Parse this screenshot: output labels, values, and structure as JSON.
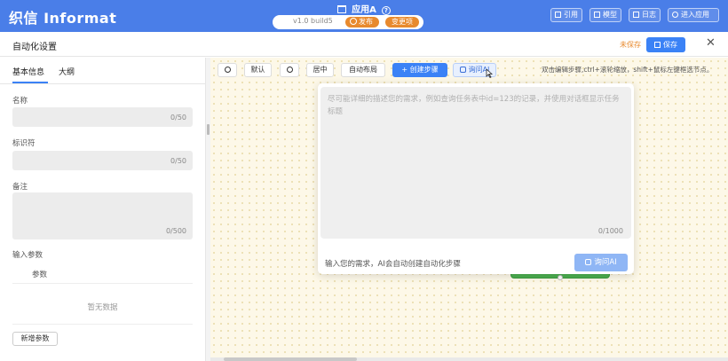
{
  "topbar": {
    "logo": "织信 Informat",
    "app_name": "应用A",
    "version": "v1.0 build5",
    "publish_label": "发布",
    "changes_label": "变更项",
    "actions": [
      {
        "label": "引用",
        "icon": "reference-icon"
      },
      {
        "label": "模型",
        "icon": "model-icon"
      },
      {
        "label": "日志",
        "icon": "log-icon"
      },
      {
        "label": "进入应用",
        "icon": "enter-app-icon"
      }
    ],
    "brand_color": "#4a7ee8",
    "accent_orange": "#e88a2e"
  },
  "header": {
    "title": "自动化设置",
    "unsaved": "未保存",
    "save_label": "保存"
  },
  "left": {
    "tabs": [
      "基本信息",
      "大纲"
    ],
    "active_tab": "基本信息",
    "fields": {
      "name": {
        "label": "名称",
        "count": "0/50"
      },
      "identifier": {
        "label": "标识符",
        "count": "0/50"
      },
      "remark": {
        "label": "备注",
        "count": "0/500"
      }
    },
    "params": {
      "section_label": "输入参数",
      "column": "参数",
      "empty": "暂无数据",
      "add_button": "新增参数"
    }
  },
  "toolbar": {
    "default_label": "默认",
    "center_label": "居中",
    "auto_layout_label": "自动布局",
    "create_step_label": "创建步骤",
    "ask_ai_label": "询问AI",
    "hint": "双击编辑步骤,ctrl+滚轮缩放，shift+鼠标左键框选节点。"
  },
  "ai_popover": {
    "placeholder": "尽可能详细的描述您的需求，例如查询任务表中id=123的记录，并使用对话框显示任务标题",
    "count": "0/1000",
    "footer_hint": "输入您的需求，AI会自动创建自动化步骤",
    "send_label": "询问AI"
  }
}
